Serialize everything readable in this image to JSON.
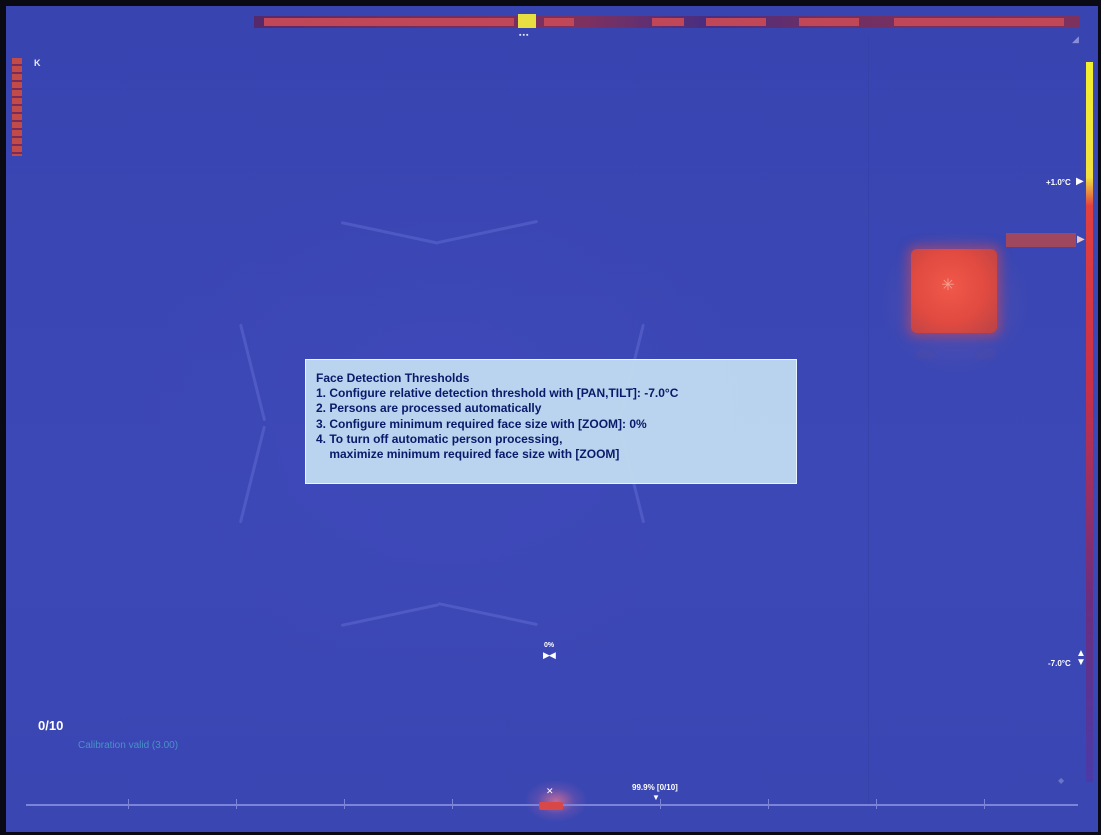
{
  "top_bar": {
    "marker_dots": "▪▪▪"
  },
  "left_panel": {
    "indicator": "K"
  },
  "temperature_scale": {
    "top_label": "+1.0°C",
    "top_arrow": "▶",
    "bottom_label": "-7.0°C",
    "bottom_arrow": "▲\n▼",
    "mid_arrow": "▶"
  },
  "info_box": {
    "title": "Face Detection Thresholds",
    "lines": [
      "1. Configure relative detection threshold with [PAN,TILT]: -7.0°C",
      "2. Persons are processed automatically",
      "3. Configure minimum required face size with [ZOOM]: 0%",
      "4. To turn off automatic person processing,",
      "    maximize minimum required face size with [ZOOM]"
    ]
  },
  "center_marker": {
    "percent": "0%",
    "icon": "▶◀"
  },
  "status": {
    "count": "0/10",
    "calibration": "Calibration valid (3.00)"
  },
  "timeline": {
    "marker_icon": "✕",
    "value_label": "99.9% [0/10]",
    "value_arrow": "▼"
  },
  "colors": {
    "background": "#3a46b2",
    "overlay_bg": "#c8e2f4",
    "overlay_text": "#0a1a6a",
    "scale_hot": "#f2f030",
    "scale_warm": "#e04040",
    "scale_cold": "#4a3aa8",
    "calibration_text": "#4a90c8"
  }
}
